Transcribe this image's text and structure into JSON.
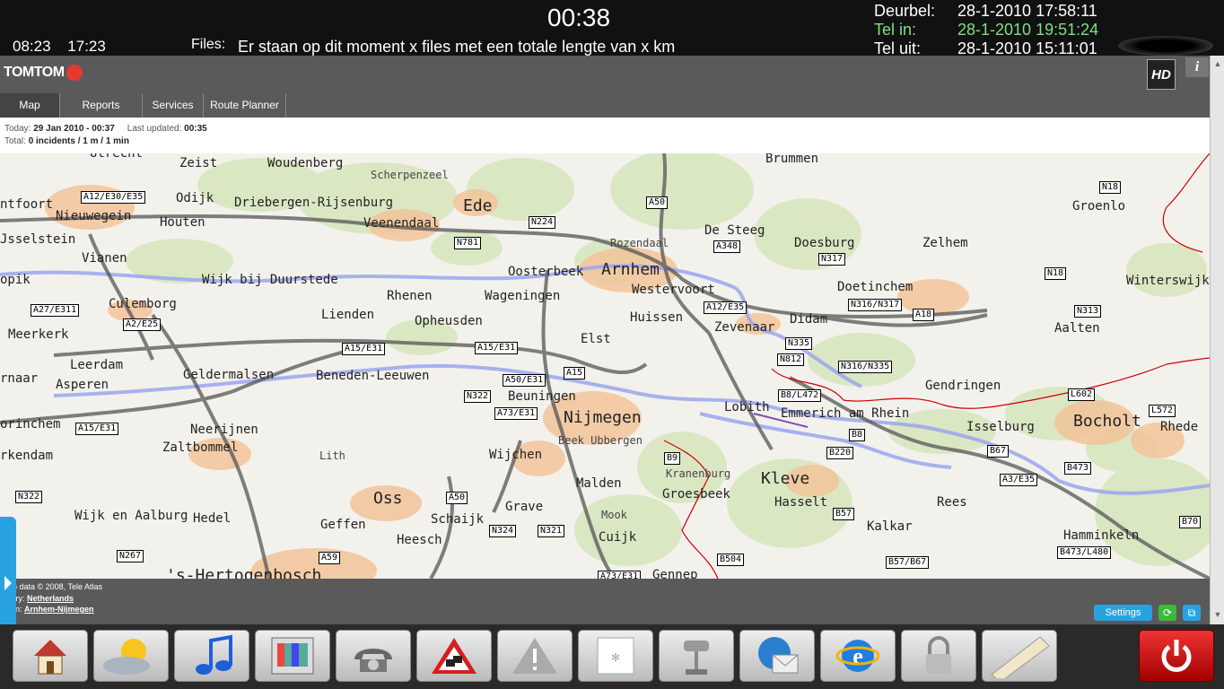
{
  "topbar": {
    "time1": "08:23",
    "time2": "17:23",
    "clock": "00:38",
    "files_label": "Files:",
    "files_text": "Er staan op dit moment x files met een totale lengte van x km",
    "status": [
      {
        "label": "Deurbel:",
        "value": "28-1-2010 17:58:11",
        "highlight": false
      },
      {
        "label": "Tel in:",
        "value": "28-1-2010 19:51:24",
        "highlight": true
      },
      {
        "label": "Tel uit:",
        "value": "28-1-2010 15:11:01",
        "highlight": false
      }
    ]
  },
  "tomtom": {
    "logo_text": "TOMTOM",
    "hd_text": "HD",
    "info_text": "i"
  },
  "tabs": [
    {
      "label": "Map",
      "active": true
    },
    {
      "label": "Reports",
      "active": false
    },
    {
      "label": "Services",
      "active": false
    },
    {
      "label": "Route Planner",
      "active": false
    }
  ],
  "info": {
    "today_label": "Today:",
    "today_value": "29 Jan 2010 - 00:37",
    "updated_label": "Last updated:",
    "updated_value": "00:35",
    "total_label": "Total:",
    "total_value": "0 incidents / 1 m / 1 min"
  },
  "map": {
    "places": [
      {
        "name": "Utrecht",
        "cls": ""
      },
      {
        "name": "Zeist",
        "cls": ""
      },
      {
        "name": "Woudenberg",
        "cls": ""
      },
      {
        "name": "Scherpenzeel",
        "cls": "small"
      },
      {
        "name": "Ede",
        "cls": "big"
      },
      {
        "name": "Brummen",
        "cls": ""
      },
      {
        "name": "Odijk",
        "cls": ""
      },
      {
        "name": "Driebergen-Rijsenburg",
        "cls": ""
      },
      {
        "name": "Veenendaal",
        "cls": ""
      },
      {
        "name": "De Steeg",
        "cls": ""
      },
      {
        "name": "Doesburg",
        "cls": ""
      },
      {
        "name": "Zelhem",
        "cls": ""
      },
      {
        "name": "Groenlo",
        "cls": ""
      },
      {
        "name": "ntfoort",
        "cls": ""
      },
      {
        "name": "Nieuwegein",
        "cls": ""
      },
      {
        "name": "Houten",
        "cls": ""
      },
      {
        "name": "Rozendaal",
        "cls": "small"
      },
      {
        "name": "Jsselstein",
        "cls": ""
      },
      {
        "name": "Vianen",
        "cls": ""
      },
      {
        "name": "Oosterbeek",
        "cls": ""
      },
      {
        "name": "Arnhem",
        "cls": "big"
      },
      {
        "name": "opik",
        "cls": ""
      },
      {
        "name": "Wijk bij Duurstede",
        "cls": ""
      },
      {
        "name": "Westervoort",
        "cls": ""
      },
      {
        "name": "Doetinchem",
        "cls": ""
      },
      {
        "name": "Winterswijk",
        "cls": ""
      },
      {
        "name": "Rhenen",
        "cls": ""
      },
      {
        "name": "Wageningen",
        "cls": ""
      },
      {
        "name": "Culemborg",
        "cls": ""
      },
      {
        "name": "Lienden",
        "cls": ""
      },
      {
        "name": "Huissen",
        "cls": ""
      },
      {
        "name": "Didam",
        "cls": ""
      },
      {
        "name": "Opheusden",
        "cls": ""
      },
      {
        "name": "Zevenaar",
        "cls": ""
      },
      {
        "name": "Aalten",
        "cls": ""
      },
      {
        "name": "Meerkerk",
        "cls": ""
      },
      {
        "name": "Elst",
        "cls": ""
      },
      {
        "name": "Leerdam",
        "cls": ""
      },
      {
        "name": "Geldermalsen",
        "cls": ""
      },
      {
        "name": "Beneden-Leeuwen",
        "cls": ""
      },
      {
        "name": "rnaar",
        "cls": ""
      },
      {
        "name": "Asperen",
        "cls": ""
      },
      {
        "name": "Gendringen",
        "cls": ""
      },
      {
        "name": "Beuningen",
        "cls": ""
      },
      {
        "name": "Lobith",
        "cls": ""
      },
      {
        "name": "Emmerich am Rhein",
        "cls": ""
      },
      {
        "name": "Nijmegen",
        "cls": "big"
      },
      {
        "name": "Bocholt",
        "cls": "big"
      },
      {
        "name": "orinchem",
        "cls": ""
      },
      {
        "name": "Neerijnen",
        "cls": ""
      },
      {
        "name": "Isselburg",
        "cls": ""
      },
      {
        "name": "Rhede",
        "cls": ""
      },
      {
        "name": "Beek Ubbergen",
        "cls": "small"
      },
      {
        "name": "Zaltbommel",
        "cls": ""
      },
      {
        "name": "rkendam",
        "cls": ""
      },
      {
        "name": "Lith",
        "cls": "small"
      },
      {
        "name": "Wijchen",
        "cls": ""
      },
      {
        "name": "Kranenburg",
        "cls": "small"
      },
      {
        "name": "Kleve",
        "cls": "big"
      },
      {
        "name": "Malden",
        "cls": ""
      },
      {
        "name": "Groesbeek",
        "cls": ""
      },
      {
        "name": "Oss",
        "cls": "big"
      },
      {
        "name": "Hasselt",
        "cls": ""
      },
      {
        "name": "Rees",
        "cls": ""
      },
      {
        "name": "Grave",
        "cls": ""
      },
      {
        "name": "Mook",
        "cls": "small"
      },
      {
        "name": "Wijk en Aalburg",
        "cls": ""
      },
      {
        "name": "Hedel",
        "cls": ""
      },
      {
        "name": "Schaijk",
        "cls": ""
      },
      {
        "name": "Geffen",
        "cls": ""
      },
      {
        "name": "Kalkar",
        "cls": ""
      },
      {
        "name": "Heesch",
        "cls": ""
      },
      {
        "name": "Cuijk",
        "cls": ""
      },
      {
        "name": "Hamminkeln",
        "cls": ""
      },
      {
        "name": "'s-Hertogenbosch",
        "cls": "big"
      },
      {
        "name": "Gennep",
        "cls": ""
      }
    ],
    "roads": [
      "A12/E30/E35",
      "A50",
      "N224",
      "N781",
      "A348",
      "N317",
      "N18",
      "N18",
      "A27/E311",
      "A2/E25",
      "A12/E35",
      "N316/N317",
      "A18",
      "N313",
      "N335",
      "A15/E31",
      "A15/E31",
      "N812",
      "N316/N335",
      "A15",
      "A50/E31",
      "B8/L472",
      "N322",
      "L602",
      "A73/E31",
      "L572",
      "A15/E31",
      "B8",
      "B67",
      "B220",
      "B9",
      "B473",
      "A3/E35",
      "N322",
      "A50",
      "B57",
      "N324",
      "N321",
      "B70",
      "N267",
      "A59",
      "B504",
      "B57/B67",
      "B473/L480",
      "A73/E31"
    ]
  },
  "under": {
    "copyright": "o data © 2008, Tele Atlas",
    "country_label": "untry:",
    "country_value": "Netherlands",
    "region_label": "gion:",
    "region_value": "Arnhem-Nijmegen",
    "settings": "Settings"
  },
  "dock": [
    "home-icon",
    "weather-icon",
    "music-icon",
    "tv-icon",
    "phone-icon",
    "traffic-warning-icon",
    "alert-icon",
    "airco-icon",
    "camera-icon",
    "mail-icon",
    "browser-icon",
    "lock-icon",
    "ruler-icon",
    "power-icon"
  ]
}
